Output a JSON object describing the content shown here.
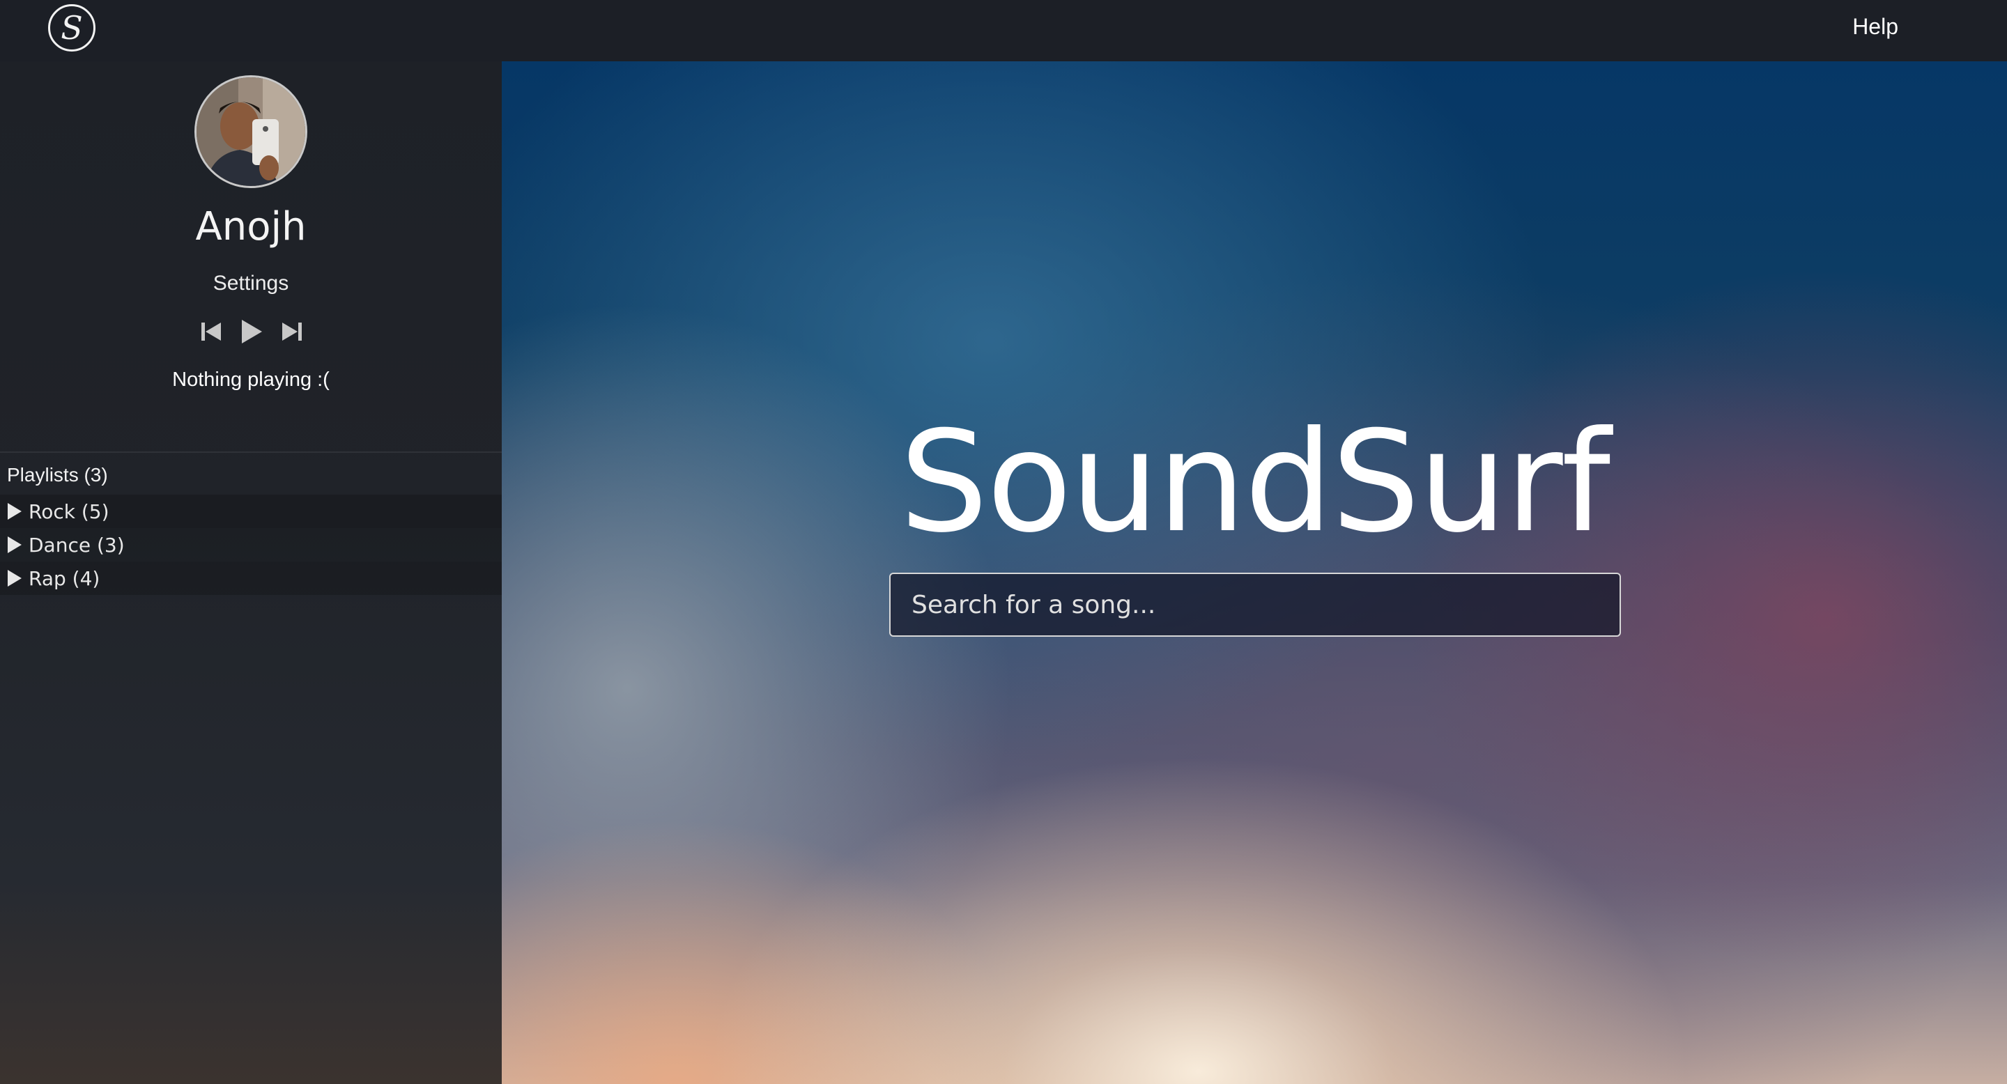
{
  "header": {
    "logo_letter": "S",
    "help_label": "Help"
  },
  "sidebar": {
    "username": "Anojh",
    "settings_label": "Settings",
    "controls": {
      "previous_icon": "skip-previous-icon",
      "play_icon": "play-icon",
      "next_icon": "skip-next-icon"
    },
    "now_playing": "Nothing playing :(",
    "playlists_header": "Playlists (3)",
    "playlists": [
      {
        "label": "Rock (5)"
      },
      {
        "label": "Dance (3)"
      },
      {
        "label": "Rap (4)"
      }
    ]
  },
  "main": {
    "title": "SoundSurf",
    "search": {
      "placeholder": "Search for a song...",
      "value": ""
    }
  },
  "colors": {
    "topbar": "#1c1f26",
    "sidebar": "#1e2127",
    "accent_text": "#ffffff"
  }
}
